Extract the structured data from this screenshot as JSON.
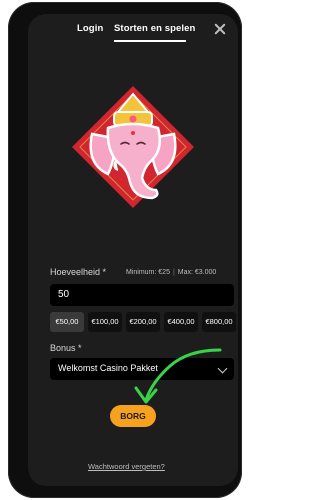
{
  "tabs": {
    "login": "Login",
    "signup": "Storten en spelen"
  },
  "icons": {
    "close": "close-icon",
    "hero": "elephant-ganesha-illustration",
    "chevron": "chevron-down-icon",
    "annotation": "hand-drawn-arrow"
  },
  "amount": {
    "label": "Hoeveelheid *",
    "min": "Minimum: €25",
    "max": "Max: €3.000",
    "value": "50"
  },
  "presets": [
    "€50,00",
    "€100,00",
    "€200,00",
    "€400,00",
    "€800,00"
  ],
  "bonus": {
    "label": "Bonus *",
    "selected": "Welkomst Casino Pakket"
  },
  "submit_label": "BORG",
  "forgot_link": "Wachtwoord vergeten?",
  "colors": {
    "accent": "#f6a21e",
    "annotation_green": "#39d34a",
    "background": "#1d1d1d",
    "hero_red": "#d1262f"
  }
}
